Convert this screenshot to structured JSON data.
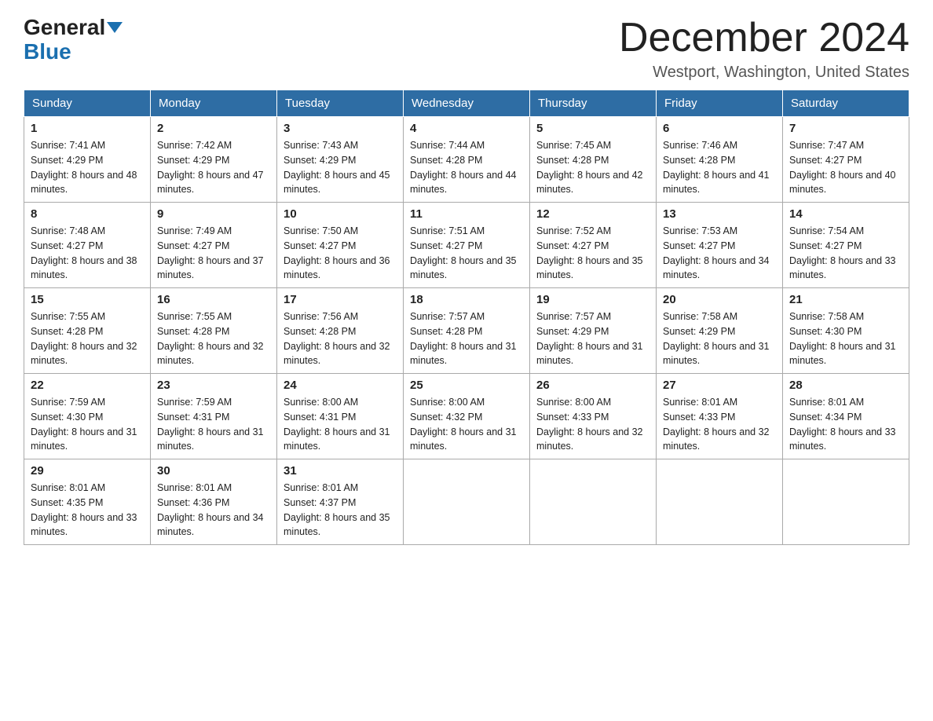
{
  "header": {
    "logo_line1": "General",
    "logo_line2": "Blue",
    "title": "December 2024",
    "subtitle": "Westport, Washington, United States"
  },
  "weekdays": [
    "Sunday",
    "Monday",
    "Tuesday",
    "Wednesday",
    "Thursday",
    "Friday",
    "Saturday"
  ],
  "weeks": [
    [
      {
        "day": "1",
        "sunrise": "7:41 AM",
        "sunset": "4:29 PM",
        "daylight": "8 hours and 48 minutes."
      },
      {
        "day": "2",
        "sunrise": "7:42 AM",
        "sunset": "4:29 PM",
        "daylight": "8 hours and 47 minutes."
      },
      {
        "day": "3",
        "sunrise": "7:43 AM",
        "sunset": "4:29 PM",
        "daylight": "8 hours and 45 minutes."
      },
      {
        "day": "4",
        "sunrise": "7:44 AM",
        "sunset": "4:28 PM",
        "daylight": "8 hours and 44 minutes."
      },
      {
        "day": "5",
        "sunrise": "7:45 AM",
        "sunset": "4:28 PM",
        "daylight": "8 hours and 42 minutes."
      },
      {
        "day": "6",
        "sunrise": "7:46 AM",
        "sunset": "4:28 PM",
        "daylight": "8 hours and 41 minutes."
      },
      {
        "day": "7",
        "sunrise": "7:47 AM",
        "sunset": "4:27 PM",
        "daylight": "8 hours and 40 minutes."
      }
    ],
    [
      {
        "day": "8",
        "sunrise": "7:48 AM",
        "sunset": "4:27 PM",
        "daylight": "8 hours and 38 minutes."
      },
      {
        "day": "9",
        "sunrise": "7:49 AM",
        "sunset": "4:27 PM",
        "daylight": "8 hours and 37 minutes."
      },
      {
        "day": "10",
        "sunrise": "7:50 AM",
        "sunset": "4:27 PM",
        "daylight": "8 hours and 36 minutes."
      },
      {
        "day": "11",
        "sunrise": "7:51 AM",
        "sunset": "4:27 PM",
        "daylight": "8 hours and 35 minutes."
      },
      {
        "day": "12",
        "sunrise": "7:52 AM",
        "sunset": "4:27 PM",
        "daylight": "8 hours and 35 minutes."
      },
      {
        "day": "13",
        "sunrise": "7:53 AM",
        "sunset": "4:27 PM",
        "daylight": "8 hours and 34 minutes."
      },
      {
        "day": "14",
        "sunrise": "7:54 AM",
        "sunset": "4:27 PM",
        "daylight": "8 hours and 33 minutes."
      }
    ],
    [
      {
        "day": "15",
        "sunrise": "7:55 AM",
        "sunset": "4:28 PM",
        "daylight": "8 hours and 32 minutes."
      },
      {
        "day": "16",
        "sunrise": "7:55 AM",
        "sunset": "4:28 PM",
        "daylight": "8 hours and 32 minutes."
      },
      {
        "day": "17",
        "sunrise": "7:56 AM",
        "sunset": "4:28 PM",
        "daylight": "8 hours and 32 minutes."
      },
      {
        "day": "18",
        "sunrise": "7:57 AM",
        "sunset": "4:28 PM",
        "daylight": "8 hours and 31 minutes."
      },
      {
        "day": "19",
        "sunrise": "7:57 AM",
        "sunset": "4:29 PM",
        "daylight": "8 hours and 31 minutes."
      },
      {
        "day": "20",
        "sunrise": "7:58 AM",
        "sunset": "4:29 PM",
        "daylight": "8 hours and 31 minutes."
      },
      {
        "day": "21",
        "sunrise": "7:58 AM",
        "sunset": "4:30 PM",
        "daylight": "8 hours and 31 minutes."
      }
    ],
    [
      {
        "day": "22",
        "sunrise": "7:59 AM",
        "sunset": "4:30 PM",
        "daylight": "8 hours and 31 minutes."
      },
      {
        "day": "23",
        "sunrise": "7:59 AM",
        "sunset": "4:31 PM",
        "daylight": "8 hours and 31 minutes."
      },
      {
        "day": "24",
        "sunrise": "8:00 AM",
        "sunset": "4:31 PM",
        "daylight": "8 hours and 31 minutes."
      },
      {
        "day": "25",
        "sunrise": "8:00 AM",
        "sunset": "4:32 PM",
        "daylight": "8 hours and 31 minutes."
      },
      {
        "day": "26",
        "sunrise": "8:00 AM",
        "sunset": "4:33 PM",
        "daylight": "8 hours and 32 minutes."
      },
      {
        "day": "27",
        "sunrise": "8:01 AM",
        "sunset": "4:33 PM",
        "daylight": "8 hours and 32 minutes."
      },
      {
        "day": "28",
        "sunrise": "8:01 AM",
        "sunset": "4:34 PM",
        "daylight": "8 hours and 33 minutes."
      }
    ],
    [
      {
        "day": "29",
        "sunrise": "8:01 AM",
        "sunset": "4:35 PM",
        "daylight": "8 hours and 33 minutes."
      },
      {
        "day": "30",
        "sunrise": "8:01 AM",
        "sunset": "4:36 PM",
        "daylight": "8 hours and 34 minutes."
      },
      {
        "day": "31",
        "sunrise": "8:01 AM",
        "sunset": "4:37 PM",
        "daylight": "8 hours and 35 minutes."
      },
      null,
      null,
      null,
      null
    ]
  ]
}
